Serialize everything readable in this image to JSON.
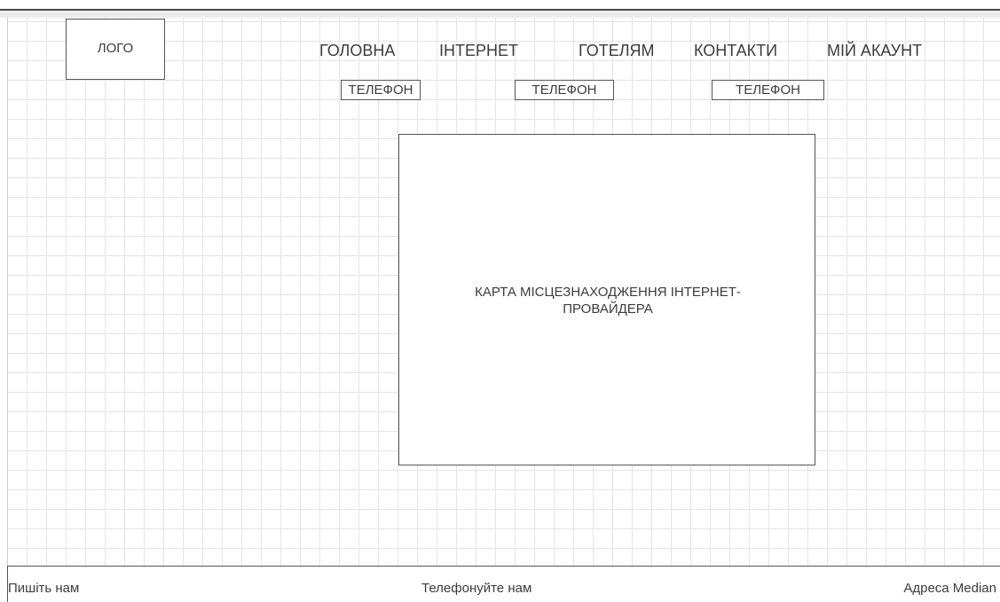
{
  "header": {
    "logo": "ЛОГО",
    "nav": [
      {
        "label": "ГОЛОВНА"
      },
      {
        "label": "ІНТЕРНЕТ"
      },
      {
        "label": "ГОТЕЛЯМ"
      },
      {
        "label": "КОНТАКТИ"
      },
      {
        "label": "МІЙ АКАУНТ"
      }
    ],
    "phones": [
      {
        "label": "ТЕЛЕФОН"
      },
      {
        "label": "ТЕЛЕФОН"
      },
      {
        "label": "ТЕЛЕФОН"
      }
    ]
  },
  "main": {
    "map_label": "КАРТА МІСЦЕЗНАХОДЖЕННЯ ІНТЕРНЕТ-ПРОВАЙДЕРА"
  },
  "footer": {
    "write_us": "Пишіть нам",
    "call_us": "Телефонуйте нам",
    "address": "Адреса Median"
  }
}
